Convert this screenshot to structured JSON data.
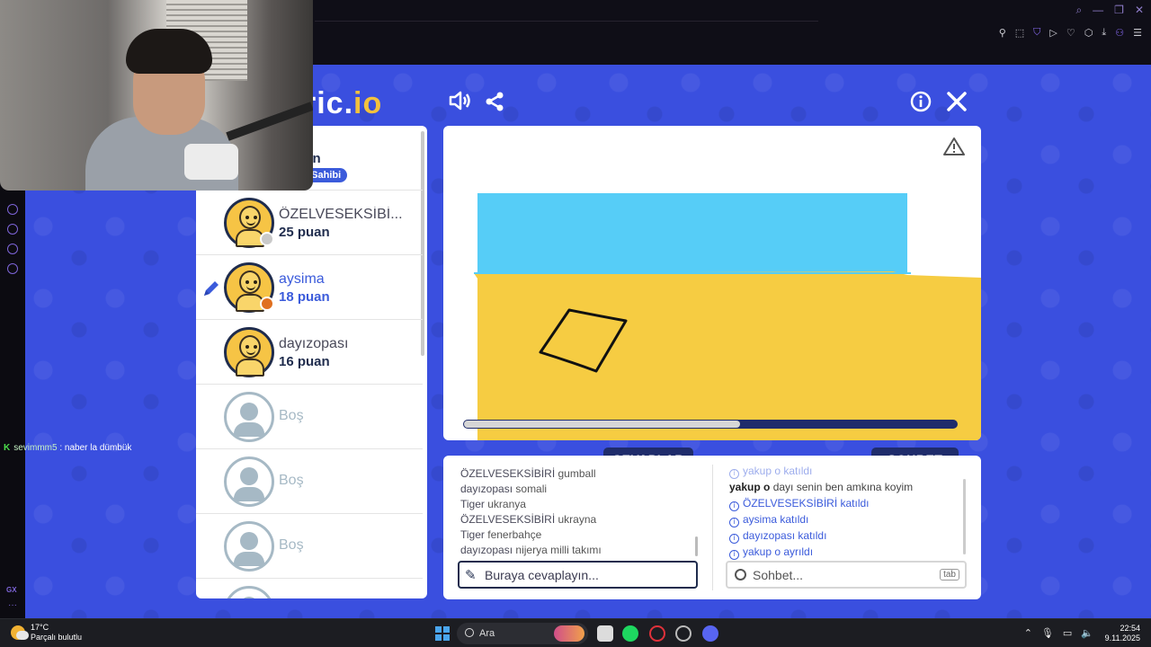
{
  "game": {
    "logo_main": "ric.",
    "logo_accent": "io",
    "icons": [
      "sound-icon",
      "share-icon",
      "info-icon",
      "close-icon"
    ]
  },
  "players": {
    "top_partial": {
      "points": "uan",
      "badge": "a Sahibi"
    },
    "list": [
      {
        "name": "ÖZELVESEKSİBİ...",
        "points": "25 puan",
        "status_color": "#c9c9c9"
      },
      {
        "name": "aysima",
        "points": "18 puan",
        "status_color": "#e07020",
        "drawing": true
      },
      {
        "name": "dayızopası",
        "points": "16 puan"
      }
    ],
    "empty_label": "Boş"
  },
  "canvas": {
    "progress_fraction": 0.56,
    "warning_icon": "warning-icon"
  },
  "answers": {
    "tab_label": "CEVAPLAR",
    "items": [
      {
        "user": "ÖZELVESEKSİBİRİ",
        "text": "gumball"
      },
      {
        "user": "dayızopası",
        "text": "somali"
      },
      {
        "user": "Tiger",
        "text": "ukranya"
      },
      {
        "user": "ÖZELVESEKSİBİRİ",
        "text": "ukrayna"
      },
      {
        "user": "Tiger",
        "text": "fenerbahçe"
      },
      {
        "user": "dayızopası",
        "text": "nijerya milli takımı"
      }
    ],
    "input_placeholder": "Buraya cevaplayın..."
  },
  "chat": {
    "tab_label": "SOHBET",
    "items": [
      {
        "kind": "system",
        "user": "yakup o",
        "text": "katıldı",
        "faded": true
      },
      {
        "kind": "message",
        "user": "yakup o",
        "text": "dayı senin ben amkına koyim"
      },
      {
        "kind": "system",
        "user": "ÖZELVESEKSİBİRİ",
        "text": "katıldı"
      },
      {
        "kind": "system",
        "user": "aysima",
        "text": "katıldı"
      },
      {
        "kind": "system",
        "user": "dayızopası",
        "text": "katıldı"
      },
      {
        "kind": "system",
        "user": "yakup o",
        "text": "ayrıldı"
      }
    ],
    "input_placeholder": "Sohbet...",
    "tab_hint": "tab"
  },
  "overlay_chat": {
    "user": "sevimmm5",
    "text": ": naber la dümbük"
  },
  "taskbar": {
    "temp": "17°C",
    "weather": "Parçalı bulutlu",
    "search_label": "Ara",
    "time": "22:54",
    "date": "9.11.2025"
  }
}
